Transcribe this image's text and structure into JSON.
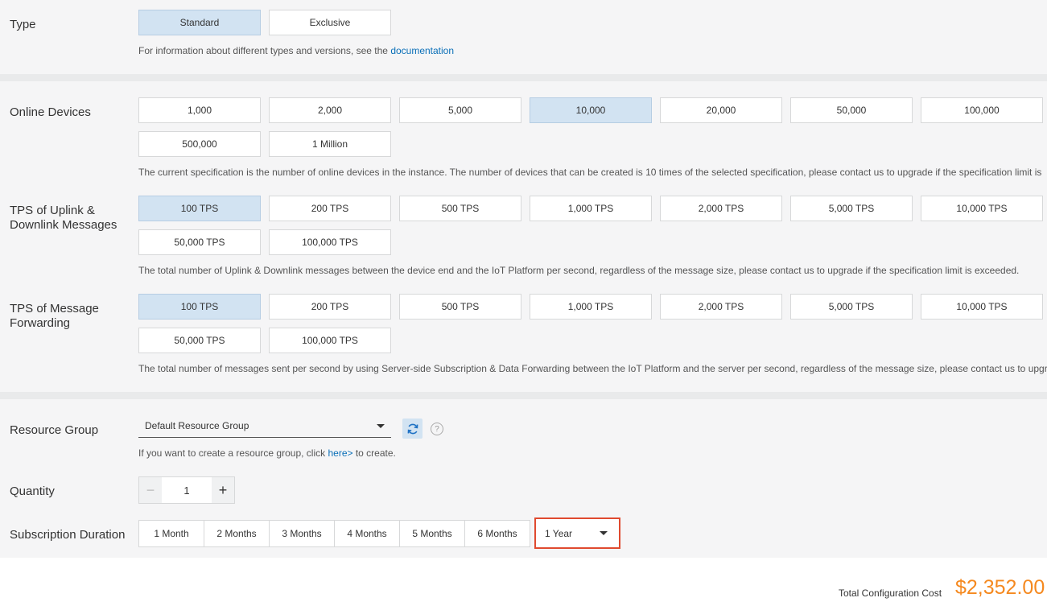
{
  "type": {
    "label": "Type",
    "options": [
      "Standard",
      "Exclusive"
    ],
    "help_prefix": "For information about different types and versions, see the",
    "help_link": "documentation"
  },
  "online_devices": {
    "label": "Online Devices",
    "options": [
      "1,000",
      "2,000",
      "5,000",
      "10,000",
      "20,000",
      "50,000",
      "100,000",
      "500,000",
      "1 Million"
    ],
    "selected": "10,000",
    "help": "The current specification is the number of online devices in the instance. The number of devices that can be created is 10 times of the selected specification, please contact us to upgrade if the specification limit is"
  },
  "tps_uplink": {
    "label_line1": "TPS of Uplink &",
    "label_line2": "Downlink Messages",
    "options": [
      "100 TPS",
      "200 TPS",
      "500 TPS",
      "1,000 TPS",
      "2,000 TPS",
      "5,000 TPS",
      "10,000 TPS",
      "50,000 TPS",
      "100,000 TPS"
    ],
    "selected": "100 TPS",
    "help": "The total number of Uplink & Downlink messages between the device end and the IoT Platform per second, regardless of the message size, please contact us to upgrade if the specification limit is exceeded."
  },
  "tps_forwarding": {
    "label_line1": "TPS of Message",
    "label_line2": "Forwarding",
    "options": [
      "100 TPS",
      "200 TPS",
      "500 TPS",
      "1,000 TPS",
      "2,000 TPS",
      "5,000 TPS",
      "10,000 TPS",
      "50,000 TPS",
      "100,000 TPS"
    ],
    "selected": "100 TPS",
    "help": "The total number of messages sent per second by using Server-side Subscription & Data Forwarding between the IoT Platform and the server per second, regardless of the message size, please contact us to upgra"
  },
  "resource_group": {
    "label": "Resource Group",
    "value": "Default Resource Group",
    "help_prefix": "If you want to create a resource group, click",
    "help_link": "here>",
    "help_suffix": "to create.",
    "question_glyph": "?"
  },
  "quantity": {
    "label": "Quantity",
    "value": "1",
    "minus": "−",
    "plus": "+"
  },
  "subscription": {
    "label": "Subscription Duration",
    "options": [
      "1 Month",
      "2 Months",
      "3 Months",
      "4 Months",
      "5 Months",
      "6 Months"
    ],
    "year_value": "1 Year"
  },
  "footer": {
    "cost_label": "Total Configuration Cost",
    "cost_value": "$2,352.00"
  },
  "colors": {
    "accent": "#0a6fb8",
    "selected_bg": "#d2e3f2",
    "highlight_border": "#e04a2f",
    "price": "#f5891f"
  }
}
